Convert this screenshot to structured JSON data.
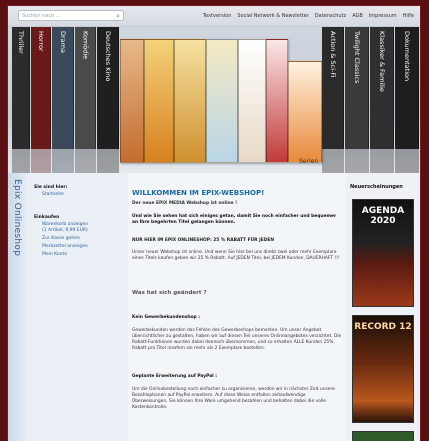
{
  "search": {
    "placeholder": "Suchen nach ..."
  },
  "topnav": [
    "Textversion",
    "Social Network & Newsletter",
    "Datenschutz",
    "AGB",
    "Impressum",
    "Hilfe"
  ],
  "banner": {
    "left_spines": [
      "Thriller",
      "Horror",
      "Drama",
      "Komödie",
      "Deutsches Kino"
    ],
    "right_spines": [
      "Action & Sci-Fi",
      "Twilight Classics",
      "Klassiker & Familie",
      "Dokumentation"
    ],
    "series_label": "Serien"
  },
  "sidebar": {
    "vertical_title": "Epix Onlineshop",
    "location_heading": "Sie sind hier:",
    "location_item": "Startseite",
    "shopping_heading": "Einkaufen",
    "cart_line1": "Warenkorb anzeigen",
    "cart_line2": "(1 Artikel, 9,99 EUR)",
    "checkout": "Zur Kasse gehen",
    "wishlist": "Merkzettel anzeigen",
    "account": "Mein Konto"
  },
  "main": {
    "title": "WILLKOMMEN IM EPIX-WEBSHOP!",
    "subtitle": "Der neue EPIX MEDIA Webshop ist online !",
    "intro": "Und wie Sie sehen hat sich einiges getan, damit Sie noch einfacher und bequemer an Ihre begehrten Titel gelangen können.",
    "discount_heading": "NUR HIER IM EPIX ONLINESHOP: 25 % RABATT FÜR JEDEN",
    "discount_text": "Unser neuer Webshop ist online. Und wenn Sie hier bei uns direkt zwei oder mehr Exemplare eines Titels kaufen geben wir 25 % Rabatt. Auf JEDEN Titel, bei JEDEM Kunden, DAUERHAFT !!!",
    "changed_heading": "Was hat sich geändert ?",
    "no_trade_heading": "Kein Gewerbekundenshop :",
    "no_trade_text": "Gewerbekunden werden das Fehlen des Gewerbeshops bemerken. Um unser Angebot übersichtlicher zu gestalten, haben wir auf diesen Teil unseres Onlineangebotes verzichtet. Die Rabatt-Funktionen wurden dabei dennoch übernommen, und so erhalten ALLE Kunden 25% Rabatt pro Titel insofern sie mehr als 2 Exemplare bestellen.",
    "paypal_heading": "Geplante Erweiterung auf PayPal :",
    "paypal_text": "Um die Onlinebestellung noch einfacher zu organisieren, werden wir in nächster Zeit unsere Bezahloptionen auf PayPal erweitern. Auf diese Weise entfallen zeitaufwendige Überweisungen, Sie können Ihre Ware umgehend bezahlen und behalten dabei die volle Kostenkontrolle."
  },
  "right": {
    "heading": "Neuerscheinungen",
    "dvds": [
      "AGENDA 2020",
      "RECORD 12"
    ]
  },
  "colors": {
    "page_border": "#5a0f13",
    "link_blue": "#1a6aa0",
    "sidebar_text": "#2d5c8f"
  }
}
